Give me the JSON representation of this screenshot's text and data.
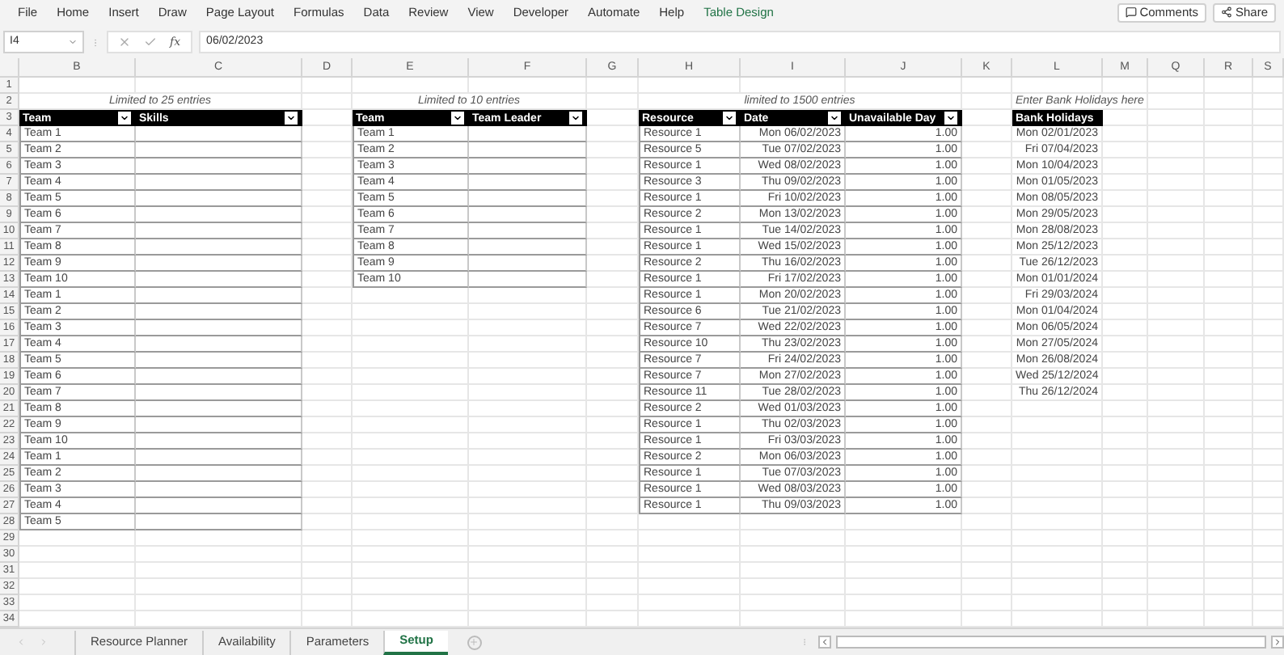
{
  "menu": [
    {
      "label": "File",
      "kind": "tab"
    },
    {
      "label": "Home",
      "kind": "tab"
    },
    {
      "label": "Insert",
      "kind": "tab"
    },
    {
      "label": "Draw",
      "kind": "tab"
    },
    {
      "label": "Page Layout",
      "kind": "tab"
    },
    {
      "label": "Formulas",
      "kind": "tab"
    },
    {
      "label": "Data",
      "kind": "tab"
    },
    {
      "label": "Review",
      "kind": "tab"
    },
    {
      "label": "View",
      "kind": "tab"
    },
    {
      "label": "Developer",
      "kind": "tab"
    },
    {
      "label": "Automate",
      "kind": "tab"
    },
    {
      "label": "Help",
      "kind": "tab"
    },
    {
      "label": "Table Design",
      "kind": "contextual"
    }
  ],
  "actions": [
    {
      "label": "Comments",
      "kind": "comments"
    },
    {
      "label": "Share",
      "kind": "share"
    }
  ],
  "formula_bar": {
    "name_box": "I4",
    "function_label": "fx",
    "formula": "06/02/2023"
  },
  "column_headers": [
    "B",
    "C",
    "D",
    "E",
    "F",
    "G",
    "H",
    "I",
    "J",
    "K",
    "L",
    "M",
    "Q",
    "R",
    "S"
  ],
  "row_headers": [
    "1",
    "2",
    "3",
    "4",
    "5",
    "6",
    "7",
    "8",
    "9",
    "10",
    "11",
    "12",
    "13",
    "14",
    "15",
    "16",
    "17",
    "18",
    "19",
    "20",
    "21",
    "22",
    "23",
    "24",
    "25",
    "26",
    "27",
    "28",
    "29",
    "30",
    "31",
    "32",
    "33",
    "34"
  ],
  "tables": [
    {
      "caption": "Limited to 25 entries",
      "bordered": true,
      "headers": [
        {
          "label": "Team",
          "kind": "text",
          "filter": true
        },
        {
          "label": "Skills",
          "kind": "text",
          "filter": true
        }
      ],
      "rows": [
        [
          "Team 1"
        ],
        [
          "Team 2"
        ],
        [
          "Team 3"
        ],
        [
          "Team 4"
        ],
        [
          "Team 5"
        ],
        [
          "Team 6"
        ],
        [
          "Team 7"
        ],
        [
          "Team 8"
        ],
        [
          "Team 9"
        ],
        [
          "Team 10"
        ],
        [
          "Team 1"
        ],
        [
          "Team 2"
        ],
        [
          "Team 3"
        ],
        [
          "Team 4"
        ],
        [
          "Team 5"
        ],
        [
          "Team 6"
        ],
        [
          "Team 7"
        ],
        [
          "Team 8"
        ],
        [
          "Team 9"
        ],
        [
          "Team 10"
        ],
        [
          "Team 1"
        ],
        [
          "Team 2"
        ],
        [
          "Team 3"
        ],
        [
          "Team 4"
        ],
        [
          "Team 5"
        ]
      ]
    },
    {
      "caption": "Limited to 10 entries",
      "bordered": true,
      "headers": [
        {
          "label": "Team",
          "kind": "text",
          "filter": true
        },
        {
          "label": "Team Leader",
          "kind": "text",
          "filter": true
        }
      ],
      "rows": [
        [
          "Team 1"
        ],
        [
          "Team 2"
        ],
        [
          "Team 3"
        ],
        [
          "Team 4"
        ],
        [
          "Team 5"
        ],
        [
          "Team 6"
        ],
        [
          "Team 7"
        ],
        [
          "Team 8"
        ],
        [
          "Team 9"
        ],
        [
          "Team 10"
        ]
      ]
    },
    {
      "caption": "limited to 1500 entries",
      "bordered": true,
      "headers": [
        {
          "label": "Resource",
          "kind": "text",
          "filter": true
        },
        {
          "label": "Date",
          "kind": "date",
          "filter": true
        },
        {
          "label": "Unavailable Day",
          "kind": "number",
          "filter": true
        }
      ],
      "rows": [
        [
          "Resource 1",
          "Mon 06/02/2023",
          "1.00"
        ],
        [
          "Resource 5",
          "Tue 07/02/2023",
          "1.00"
        ],
        [
          "Resource 1",
          "Wed 08/02/2023",
          "1.00"
        ],
        [
          "Resource 3",
          "Thu 09/02/2023",
          "1.00"
        ],
        [
          "Resource 1",
          "Fri 10/02/2023",
          "1.00"
        ],
        [
          "Resource 2",
          "Mon 13/02/2023",
          "1.00"
        ],
        [
          "Resource 1",
          "Tue 14/02/2023",
          "1.00"
        ],
        [
          "Resource 1",
          "Wed 15/02/2023",
          "1.00"
        ],
        [
          "Resource 2",
          "Thu 16/02/2023",
          "1.00"
        ],
        [
          "Resource 1",
          "Fri 17/02/2023",
          "1.00"
        ],
        [
          "Resource 1",
          "Mon 20/02/2023",
          "1.00"
        ],
        [
          "Resource 6",
          "Tue 21/02/2023",
          "1.00"
        ],
        [
          "Resource 7",
          "Wed 22/02/2023",
          "1.00"
        ],
        [
          "Resource 10",
          "Thu 23/02/2023",
          "1.00"
        ],
        [
          "Resource 7",
          "Fri 24/02/2023",
          "1.00"
        ],
        [
          "Resource 7",
          "Mon 27/02/2023",
          "1.00"
        ],
        [
          "Resource 11",
          "Tue 28/02/2023",
          "1.00"
        ],
        [
          "Resource 2",
          "Wed 01/03/2023",
          "1.00"
        ],
        [
          "Resource 1",
          "Thu 02/03/2023",
          "1.00"
        ],
        [
          "Resource 1",
          "Fri 03/03/2023",
          "1.00"
        ],
        [
          "Resource 2",
          "Mon 06/03/2023",
          "1.00"
        ],
        [
          "Resource 1",
          "Tue 07/03/2023",
          "1.00"
        ],
        [
          "Resource 1",
          "Wed 08/03/2023",
          "1.00"
        ],
        [
          "Resource 1",
          "Thu 09/03/2023",
          "1.00"
        ]
      ]
    },
    {
      "caption": "Enter Bank Holidays here",
      "bordered": false,
      "headers": [
        {
          "label": "Bank Holidays",
          "kind": "date",
          "filter": false
        }
      ],
      "rows": [
        [
          "Mon 02/01/2023"
        ],
        [
          "Fri 07/04/2023"
        ],
        [
          "Mon 10/04/2023"
        ],
        [
          "Mon 01/05/2023"
        ],
        [
          "Mon 08/05/2023"
        ],
        [
          "Mon 29/05/2023"
        ],
        [
          "Mon 28/08/2023"
        ],
        [
          "Mon 25/12/2023"
        ],
        [
          "Tue 26/12/2023"
        ],
        [
          "Mon 01/01/2024"
        ],
        [
          "Fri 29/03/2024"
        ],
        [
          "Mon 01/04/2024"
        ],
        [
          "Mon 06/05/2024"
        ],
        [
          "Mon 27/05/2024"
        ],
        [
          "Mon 26/08/2024"
        ],
        [
          "Wed 25/12/2024"
        ],
        [
          "Thu 26/12/2024"
        ]
      ]
    }
  ],
  "sheet_tabs": [
    {
      "label": "Resource Planner",
      "selected": false
    },
    {
      "label": "Availability",
      "selected": false
    },
    {
      "label": "Parameters",
      "selected": false
    },
    {
      "label": "Setup",
      "selected": true
    }
  ]
}
